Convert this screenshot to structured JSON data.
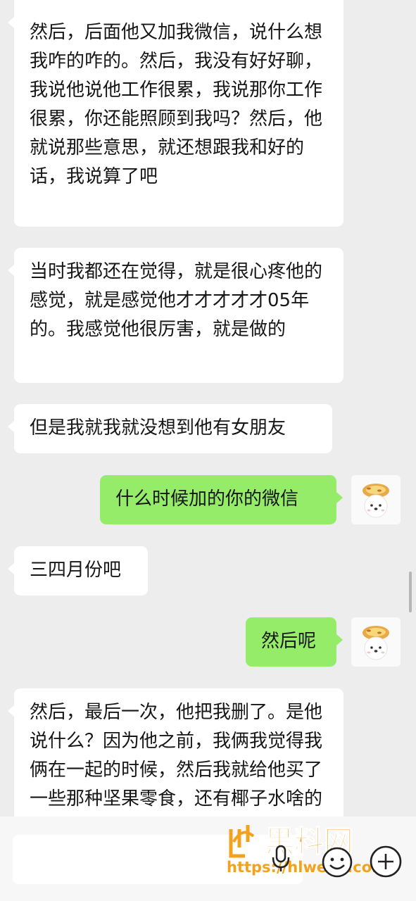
{
  "messages": [
    {
      "side": "in",
      "text": "然后，后面他又加我微信，说什么想我咋的咋的。然后，我没有好好聊，我说他说他工作很累，我说那你工作很累，你还能照顾到我吗？然后，他就说那些意思，就还想跟我和好的话，我说算了吧"
    },
    {
      "side": "in",
      "text": "当时我都还在觉得，就是很心疼他的感觉，就是感觉他才才才才才05年的。我感觉他很厉害，就是做的"
    },
    {
      "side": "in",
      "text": "但是我就我就没想到他有女朋友"
    },
    {
      "side": "out",
      "text": "什么时候加的你的微信"
    },
    {
      "side": "in",
      "text": "三四月份吧"
    },
    {
      "side": "out",
      "text": "然后呢"
    },
    {
      "side": "in",
      "text": "然后，最后一次，他把我删了。是他说什么？因为他之前，我俩我觉得我俩在一起的时候，然后我就给他买了一些那种坚果零食，还有椰子水啥的"
    }
  ],
  "avatar_icon": "dog-with-egg-tart-avatar",
  "input": {
    "placeholder": ""
  },
  "watermark": {
    "logo_text": "黑料网",
    "url": "https://hlwe10.com"
  },
  "colors": {
    "background": "#ededed",
    "incoming": "#ffffff",
    "outgoing": "#95ec69",
    "watermark": "#f4a21b"
  }
}
